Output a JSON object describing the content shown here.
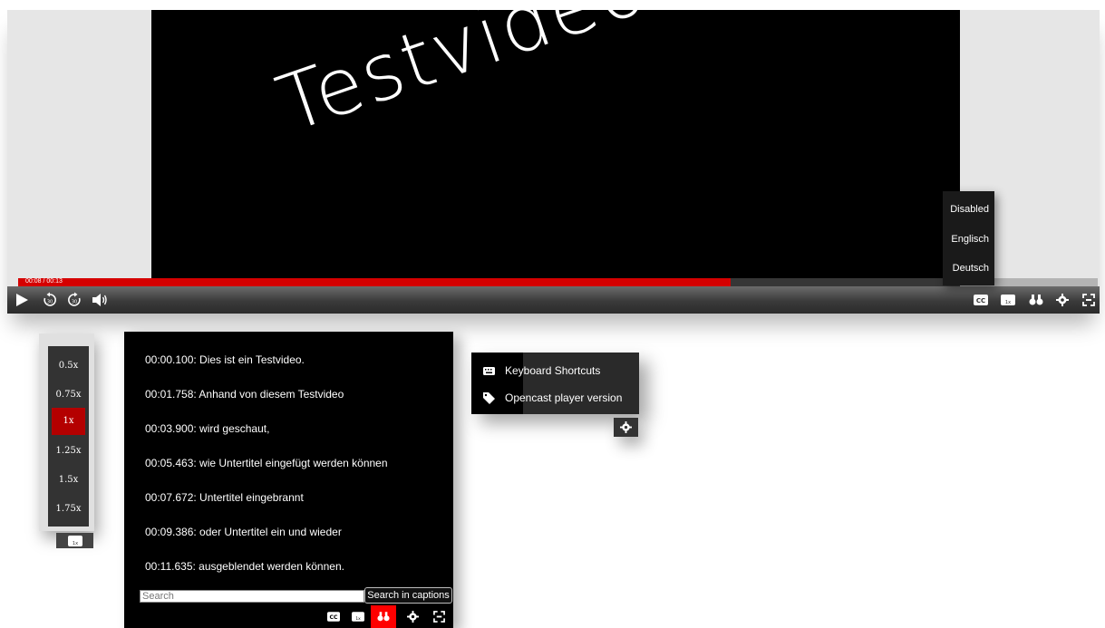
{
  "video": {
    "title_text": "Testvideo"
  },
  "player": {
    "time_readout": "00:08 / 00:13",
    "progress_fraction": 0.66
  },
  "caption_menu": {
    "options": [
      "Disabled",
      "Englisch",
      "Deutsch"
    ]
  },
  "speed_menu": {
    "options": [
      "0.5x",
      "0.75x",
      "1x",
      "1.25x",
      "1.5x",
      "1.75x"
    ],
    "selected": "1x",
    "button_label": "1x"
  },
  "captions": {
    "lines": [
      "00:00.100: Dies ist ein Testvideo.",
      "00:01.758: Anhand von diesem Testvideo",
      "00:03.900: wird geschaut,",
      "00:05.463: wie Untertitel eingefügt werden können",
      "00:07.672: Untertitel eingebrannt",
      "00:09.386: oder Untertitel ein und wieder",
      "00:11.635: ausgeblendet werden können."
    ],
    "search_placeholder": "Search",
    "search_tooltip": "Search in captions"
  },
  "settings_menu": {
    "items": [
      {
        "label": "Keyboard Shortcuts",
        "icon": "keyboard-icon"
      },
      {
        "label": "Opencast player version",
        "icon": "tag-icon"
      }
    ]
  },
  "colors": {
    "accent": "#d50000",
    "active_speed": "#b40000",
    "search_active": "#ff0000"
  }
}
